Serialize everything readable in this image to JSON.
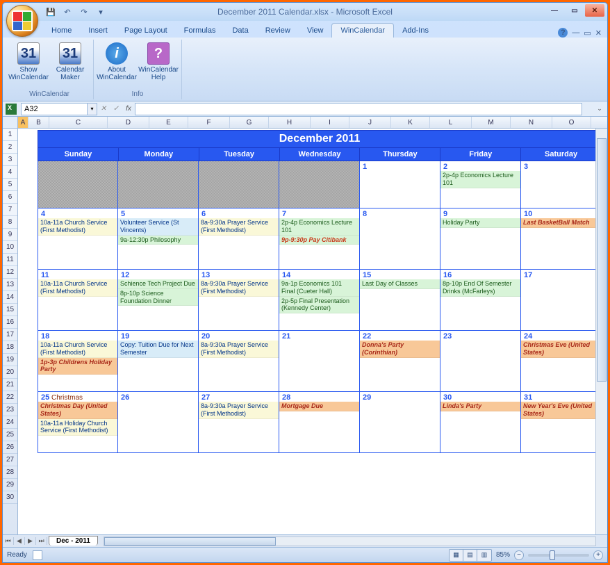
{
  "title": "December 2011 Calendar.xlsx - Microsoft Excel",
  "qat": {
    "save": "💾",
    "undo": "↶",
    "redo": "↷"
  },
  "menu": [
    "Home",
    "Insert",
    "Page Layout",
    "Formulas",
    "Data",
    "Review",
    "View",
    "WinCalendar",
    "Add-Ins"
  ],
  "active_menu": "WinCalendar",
  "ribbon": {
    "groups": [
      {
        "label": "WinCalendar",
        "buttons": [
          {
            "icon": "31",
            "icon_class": "blue-cal",
            "label": "Show WinCalendar"
          },
          {
            "icon": "31",
            "icon_class": "blue-cal",
            "label": "Calendar Maker"
          }
        ]
      },
      {
        "label": "Info",
        "buttons": [
          {
            "icon": "i",
            "icon_class": "info",
            "label": "About WinCalendar"
          },
          {
            "icon": "?",
            "icon_class": "help",
            "label": "WinCalendar Help"
          }
        ]
      }
    ]
  },
  "namebox": "A32",
  "fx_label": "fx",
  "columns": [
    {
      "l": "A",
      "w": 15
    },
    {
      "l": "B",
      "w": 30
    },
    {
      "l": "C",
      "w": 84
    },
    {
      "l": "D",
      "w": 60
    },
    {
      "l": "E",
      "w": 56
    },
    {
      "l": "F",
      "w": 60
    },
    {
      "l": "G",
      "w": 56
    },
    {
      "l": "H",
      "w": 60
    },
    {
      "l": "I",
      "w": 56
    },
    {
      "l": "J",
      "w": 60
    },
    {
      "l": "K",
      "w": 56
    },
    {
      "l": "L",
      "w": 60
    },
    {
      "l": "M",
      "w": 56
    },
    {
      "l": "N",
      "w": 60
    },
    {
      "l": "O",
      "w": 56
    }
  ],
  "rows": [
    "1",
    "2",
    "3",
    "4",
    "5",
    "6",
    "7",
    "8",
    "9",
    "10",
    "11",
    "12",
    "13",
    "14",
    "15",
    "16",
    "17",
    "18",
    "19",
    "20",
    "21",
    "22",
    "23",
    "24",
    "25",
    "26",
    "27",
    "28",
    "29",
    "30"
  ],
  "calendar": {
    "title": "December 2011",
    "days": [
      "Sunday",
      "Monday",
      "Tuesday",
      "Wednesday",
      "Thursday",
      "Friday",
      "Saturday"
    ],
    "weeks": [
      [
        {
          "inactive": true
        },
        {
          "inactive": true
        },
        {
          "inactive": true
        },
        {
          "inactive": true
        },
        {
          "num": "1",
          "events": []
        },
        {
          "num": "2",
          "events": [
            {
              "t": "2p-4p Economics Lecture 101",
              "c": "green"
            }
          ]
        },
        {
          "num": "3",
          "events": []
        }
      ],
      [
        {
          "num": "4",
          "events": [
            {
              "t": "10a-11a Church Service (First Methodist)",
              "c": "yellow"
            }
          ]
        },
        {
          "num": "5",
          "events": [
            {
              "t": "Volunteer Service (St Vincents)",
              "c": "lightblue"
            },
            {
              "t": "9a-12:30p Philosophy",
              "c": "green"
            }
          ]
        },
        {
          "num": "6",
          "events": [
            {
              "t": "8a-9:30a Prayer Service (First Methodist)",
              "c": "yellow"
            }
          ]
        },
        {
          "num": "7",
          "events": [
            {
              "t": "2p-4p Economics Lecture 101",
              "c": "green"
            },
            {
              "t": "9p-9:30p Pay Citibank",
              "c": "red-on-green"
            }
          ]
        },
        {
          "num": "8",
          "events": []
        },
        {
          "num": "9",
          "events": [
            {
              "t": "Holiday Party",
              "c": "green"
            }
          ]
        },
        {
          "num": "10",
          "events": [
            {
              "t": "Last BasketBall Match",
              "c": "orange"
            }
          ]
        }
      ],
      [
        {
          "num": "11",
          "events": [
            {
              "t": "10a-11a Church Service (First Methodist)",
              "c": "yellow"
            }
          ]
        },
        {
          "num": "12",
          "events": [
            {
              "t": " Schience Tech Project Due",
              "c": "green"
            },
            {
              "t": "8p-10p Science Foundation Dinner",
              "c": "green"
            }
          ]
        },
        {
          "num": "13",
          "events": [
            {
              "t": "8a-9:30a Prayer Service (First Methodist)",
              "c": "yellow"
            }
          ]
        },
        {
          "num": "14",
          "events": [
            {
              "t": "9a-1p Economics 101 Final (Cueter Hall)",
              "c": "green"
            },
            {
              "t": "2p-5p Final Presentation (Kennedy Center)",
              "c": "green"
            }
          ]
        },
        {
          "num": "15",
          "events": [
            {
              "t": "Last Day of Classes",
              "c": "green"
            }
          ]
        },
        {
          "num": "16",
          "events": [
            {
              "t": "8p-10p End Of Semester Drinks (McFarleys)",
              "c": "green"
            }
          ]
        },
        {
          "num": "17",
          "events": []
        }
      ],
      [
        {
          "num": "18",
          "events": [
            {
              "t": "10a-11a Church Service (First Methodist)",
              "c": "yellow"
            },
            {
              "t": "1p-3p Childrens Holiday Party",
              "c": "orange"
            }
          ]
        },
        {
          "num": "19",
          "events": [
            {
              "t": "Copy: Tuition Due for Next Semester",
              "c": "lightblue"
            }
          ]
        },
        {
          "num": "20",
          "events": [
            {
              "t": "8a-9:30a Prayer Service (First Methodist)",
              "c": "yellow"
            }
          ]
        },
        {
          "num": "21",
          "events": []
        },
        {
          "num": "22",
          "events": [
            {
              "t": " Donna's Party (Corinthian)",
              "c": "orange"
            }
          ]
        },
        {
          "num": "23",
          "events": []
        },
        {
          "num": "24",
          "events": [
            {
              "t": " Christmas Eve (United States)",
              "c": "orange"
            }
          ]
        }
      ],
      [
        {
          "num": "25",
          "holiday": "Christmas",
          "events": [
            {
              "t": " Christmas Day (United States)",
              "c": "orange"
            },
            {
              "t": "10a-11a Holiday Church Service (First Methodist)",
              "c": "yellow"
            }
          ]
        },
        {
          "num": "26",
          "events": []
        },
        {
          "num": "27",
          "events": [
            {
              "t": "8a-9:30a Prayer Service (First Methodist)",
              "c": "yellow"
            }
          ]
        },
        {
          "num": "28",
          "events": [
            {
              "t": "Mortgage Due",
              "c": "orange"
            }
          ]
        },
        {
          "num": "29",
          "events": []
        },
        {
          "num": "30",
          "events": [
            {
              "t": " Linda's Party",
              "c": "orange"
            }
          ]
        },
        {
          "num": "31",
          "events": [
            {
              "t": " New Year's Eve (United States)",
              "c": "orange"
            }
          ]
        }
      ]
    ]
  },
  "sheet_tab": "Dec - 2011",
  "status": "Ready",
  "zoom": "85%"
}
